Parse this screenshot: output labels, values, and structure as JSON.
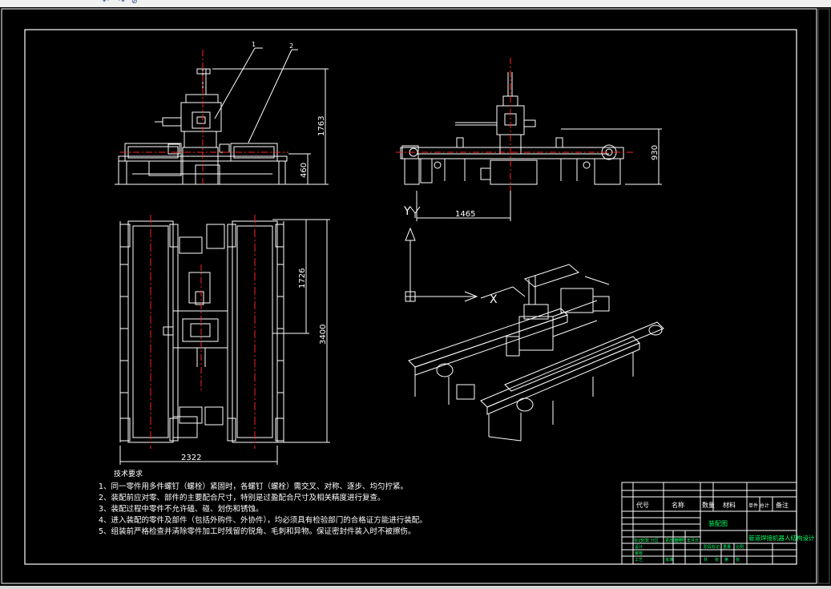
{
  "window": {
    "toolbar_glyphs": [
      "↶",
      "↷",
      "⊘"
    ]
  },
  "drawing": {
    "balloons": [
      "1",
      "2"
    ],
    "dims_front": {
      "height_total": "1763",
      "height_lower": "460"
    },
    "dims_side": {
      "height": "930",
      "offset": "1465"
    },
    "dims_top": {
      "length_total": "3400",
      "length_part": "1726",
      "width": "2322"
    },
    "ucs": {
      "y_label": "Y",
      "x_label": "X"
    },
    "tech_requirements": {
      "title": "技术要求",
      "items": [
        "1、同一零件用多件螺钉（螺栓）紧固时，各螺钉（螺栓）需交叉、对称、逐步、均匀拧紧。",
        "2、装配前应对零、部件的主要配合尺寸，特别是过盈配合尺寸及相关精度进行复查。",
        "3、装配过程中零件不允许磕、碰、划伤和锈蚀。",
        "4、进入装配的零件及部件（包括外购件、外协件），均必须具有检验部门的合格证方能进行装配。",
        "5、组装前严格检查并清除零件加工时残留的锐角、毛刺和异物。保证密封件装入时不被擦伤。"
      ]
    },
    "title_block": {
      "header_cols": [
        "代号",
        "名称",
        "数量",
        "材料",
        "单件 总计",
        "备注"
      ],
      "drawing_name": "装配图",
      "project_title": "管道焊接机器人结构设计",
      "small_labels": [
        "标记",
        "处数",
        "分区",
        "更改文件号",
        "签名",
        "年月日",
        "设计",
        "审核",
        "工艺",
        "批准",
        "阶段标记",
        "重量",
        "比例",
        "共",
        "张",
        "第",
        "张"
      ]
    }
  },
  "colors": {
    "background": "#000000",
    "lines": "#ffffff",
    "centerline": "#ff2020",
    "title_text": "#00ff66"
  }
}
